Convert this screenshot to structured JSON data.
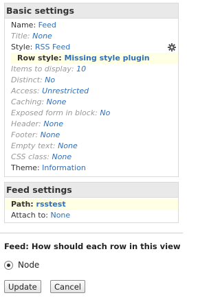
{
  "basic_settings": {
    "title": "Basic settings",
    "rows": [
      {
        "label": "Name:",
        "value": "Feed"
      },
      {
        "label": "Title:",
        "value": "None"
      },
      {
        "label": "Style:",
        "value": "RSS Feed"
      },
      {
        "sub_label": "Row style:",
        "sub_value": "Missing style plugin"
      },
      {
        "label": "Items to display:",
        "value": "10"
      },
      {
        "label": "Distinct:",
        "value": "No"
      },
      {
        "label": "Access:",
        "value": "Unrestricted"
      },
      {
        "label": "Caching:",
        "value": "None"
      },
      {
        "label": "Exposed form in block:",
        "value": "No"
      },
      {
        "label": "Header:",
        "value": "None"
      },
      {
        "label": "Footer:",
        "value": "None"
      },
      {
        "label": "Empty text:",
        "value": "None"
      },
      {
        "label": "CSS class:",
        "value": "None"
      },
      {
        "label": "Theme:",
        "value": "Information"
      }
    ]
  },
  "feed_settings": {
    "title": "Feed settings",
    "path_label": "Path:",
    "path_value": "rsstest",
    "attach_label": "Attach to:",
    "attach_value": "None"
  },
  "form": {
    "question": "Feed: How should each row in this view",
    "option_label": "Node",
    "update_label": "Update",
    "cancel_label": "Cancel"
  },
  "icons": {
    "style_settings": "gear-icon"
  },
  "colors": {
    "link": "#2f6fb8",
    "highlight": "#ffffe3",
    "header_bg": "#e9e9e9"
  }
}
